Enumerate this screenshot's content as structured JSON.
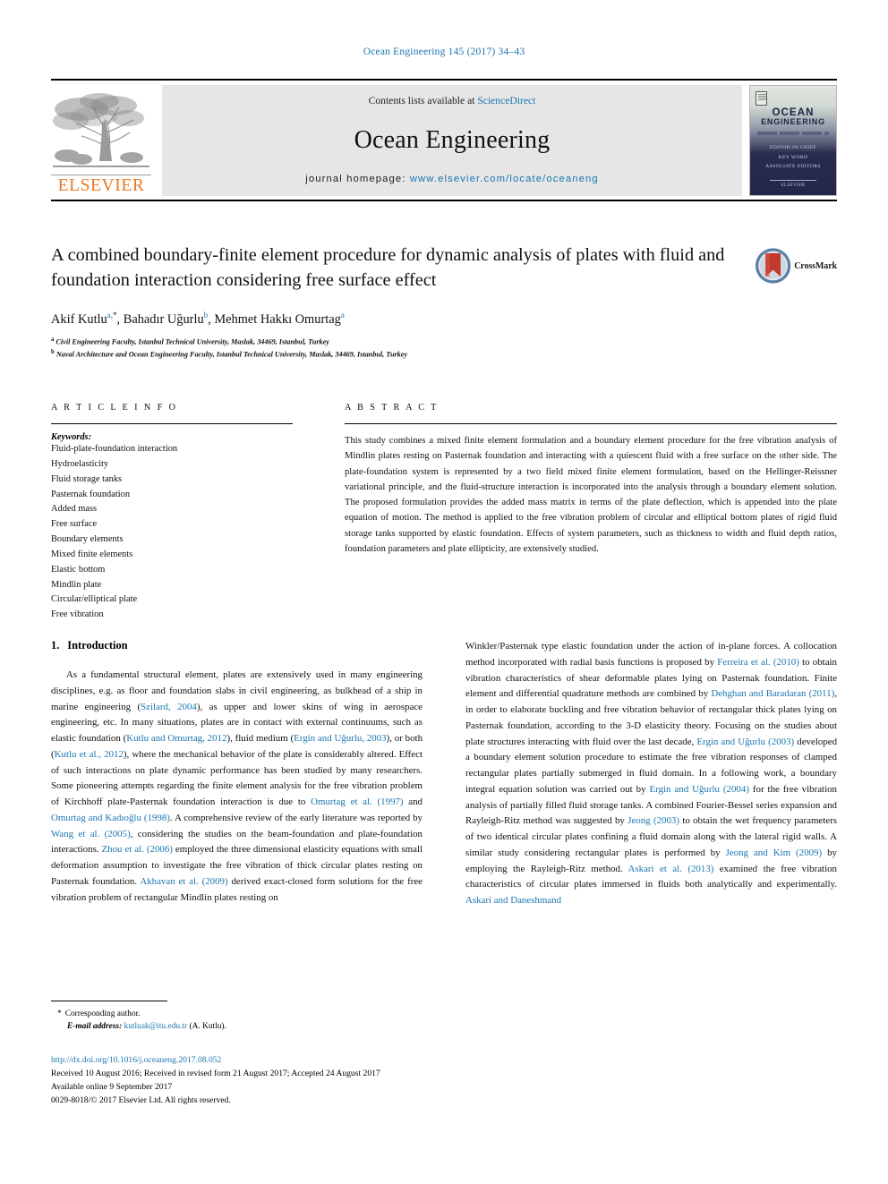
{
  "running_head": "Ocean Engineering 145 (2017) 34–43",
  "banner": {
    "publisher_word": "ELSEVIER",
    "contents_prefix": "Contents lists available at ",
    "contents_link": "ScienceDirect",
    "journal_title": "Ocean Engineering",
    "homepage_label": "journal homepage: ",
    "homepage_url": "www.elsevier.com/locate/oceaneng",
    "cover": {
      "title": "OCEAN",
      "subtitle": "ENGINEERING",
      "tagline": "AN INTERNATIONAL JOURNAL OF RESEARCH AND DEVELOPMENT",
      "mid_lines": [
        "EDITOR-IN-CHIEF",
        "KEY WORD",
        "ASSOCIATE EDITORS"
      ],
      "foot": "ELSEVIER"
    }
  },
  "article": {
    "title": "A combined boundary-finite element procedure for dynamic analysis of plates with fluid and foundation interaction considering free surface effect",
    "crossmark_label": "CrossMark",
    "authors": [
      {
        "name": "Akif Kutlu",
        "marks": "a,",
        "star": "*"
      },
      {
        "name": "Bahadır Uğurlu",
        "marks": "b"
      },
      {
        "name": "Mehmet Hakkı Omurtag",
        "marks": "a"
      }
    ],
    "affiliations": [
      {
        "mark": "a",
        "text": "Civil Engineering Faculty, Istanbul Technical University, Maslak, 34469, Istanbul, Turkey"
      },
      {
        "mark": "b",
        "text": "Naval Architecture and Ocean Engineering Faculty, Istanbul Technical University, Maslak, 34469, Istanbul, Turkey"
      }
    ]
  },
  "article_info": {
    "heading": "A R T I C L E  I N F O",
    "keywords_label": "Keywords:",
    "keywords": [
      "Fluid-plate-foundation interaction",
      "Hydroelasticity",
      "Fluid storage tanks",
      "Pasternak foundation",
      "Added mass",
      "Free surface",
      "Boundary elements",
      "Mixed finite elements",
      "Elastic bottom",
      "Mindlin plate",
      "Circular/elliptical plate",
      "Free vibration"
    ]
  },
  "abstract": {
    "heading": "A B S T R A C T",
    "text": "This study combines a mixed finite element formulation and a boundary element procedure for the free vibration analysis of Mindlin plates resting on Pasternak foundation and interacting with a quiescent fluid with a free surface on the other side. The plate-foundation system is represented by a two field mixed finite element formulation, based on the Hellinger-Reissner variational principle, and the fluid-structure interaction is incorporated into the analysis through a boundary element solution. The proposed formulation provides the added mass matrix in terms of the plate deflection, which is appended into the plate equation of motion. The method is applied to the free vibration problem of circular and elliptical bottom plates of rigid fluid storage tanks supported by elastic foundation. Effects of system parameters, such as thickness to width and fluid depth ratios, foundation parameters and plate ellipticity, are extensively studied."
  },
  "body": {
    "section_number": "1.",
    "section_title": "Introduction",
    "left_column_html": "As a fundamental structural element, plates are extensively used in many engineering disciplines, e.g. as floor and foundation slabs in civil engineering, as bulkhead of a ship in marine engineering (<span class=\"cite\">Szilard, 2004</span>), as upper and lower skins of wing in aerospace engineering, etc. In many situations, plates are in contact with external continuums, such as elastic foundation (<span class=\"cite\">Kutlu and Omurtag, 2012</span>), fluid medium (<span class=\"cite\">Ergin and Uğurlu, 2003</span>), or both (<span class=\"cite\">Kutlu et al., 2012</span>), where the mechanical behavior of the plate is considerably altered. Effect of such interactions on plate dynamic performance has been studied by many researchers. Some pioneering attempts regarding the finite element analysis for the free vibration problem of Kirchhoff plate-Pasternak foundation interaction is due to <span class=\"cite\">Omurtag et al. (1997)</span> and <span class=\"cite\">Omurtag and Kadıoğlu (1998)</span>. A comprehensive review of the early literature was reported by <span class=\"cite\">Wang et al. (2005)</span>, considering the studies on the beam-foundation and plate-foundation interactions. <span class=\"cite\">Zhou et al. (2006)</span> employed the three dimensional elasticity equations with small deformation assumption to investigate the free vibration of thick circular plates resting on Pasternak foundation. <span class=\"cite\">Akhavan et al. (2009)</span> derived exact-closed form solutions for the free vibration problem of rectangular Mindlin plates resting on",
    "right_column_html": "Winkler/Pasternak type elastic foundation under the action of in-plane forces. A collocation method incorporated with radial basis functions is proposed by <span class=\"cite\">Ferreira et al. (2010)</span> to obtain vibration characteristics of shear deformable plates lying on Pasternak foundation. Finite element and differential quadrature methods are combined by <span class=\"cite\">Dehghan and Baradaran (2011)</span>, in order to elaborate buckling and free vibration behavior of rectangular thick plates lying on Pasternak foundation, according to the 3-D elasticity theory. Focusing on the studies about plate structures interacting with fluid over the last decade, <span class=\"cite\">Ergin and Uğurlu (2003)</span> developed a boundary element solution procedure to estimate the free vibration responses of clamped rectangular plates partially submerged in fluid domain. In a following work, a boundary integral equation solution was carried out by <span class=\"cite\">Ergin and Uğurlu (2004)</span> for the free vibration analysis of partially filled fluid storage tanks. A combined Fourier-Bessel series expansion and Rayleigh-Ritz method was suggested by <span class=\"cite\">Jeong (2003)</span> to obtain the wet frequency parameters of two identical circular plates confining a fluid domain along with the lateral rigid walls. A similar study considering rectangular plates is performed by <span class=\"cite\">Jeong and Kim (2009)</span> by employing the Rayleigh-Ritz method. <span class=\"cite\">Askari et al. (2013)</span> examined the free vibration characteristics of circular plates immersed in fluids both analytically and experimentally. <span class=\"cite\">Askari and Daneshmand</span>"
  },
  "footnote": {
    "corresponding": "Corresponding author.",
    "star": "*",
    "email_label": "E-mail address:",
    "email": "kutluak@itu.edu.tr",
    "email_suffix": "(A. Kutlu)."
  },
  "footer": {
    "doi": "http://dx.doi.org/10.1016/j.oceaneng.2017.08.052",
    "history": "Received 10 August 2016; Received in revised form 21 August 2017; Accepted 24 August 2017",
    "available": "Available online 9 September 2017",
    "copyright": "0029-8018/© 2017 Elsevier Ltd. All rights reserved."
  },
  "colors": {
    "link": "#1b76b0",
    "elsevier_orange": "#e87722",
    "banner_grey": "#e6e6e6",
    "crossmark_red": "#c0392b"
  }
}
